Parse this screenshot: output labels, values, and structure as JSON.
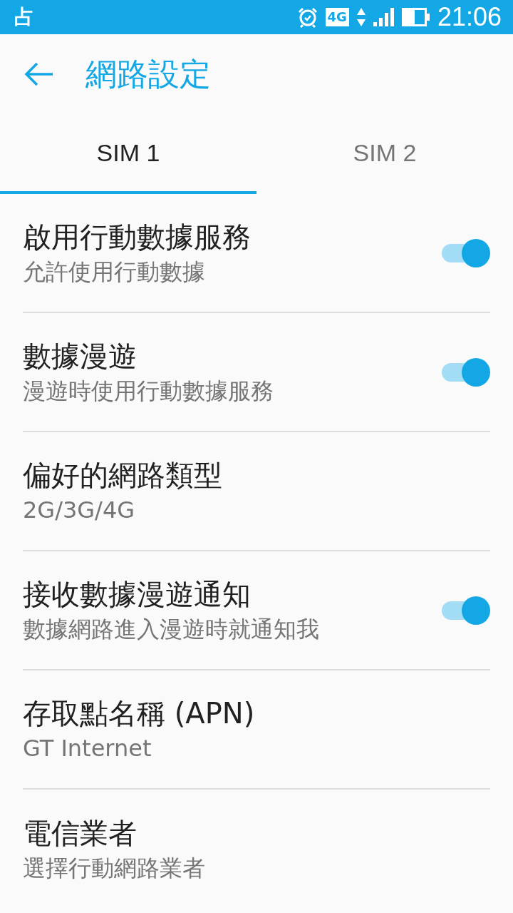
{
  "status_bar": {
    "notification": "占",
    "network_type": "4G",
    "time": "21:06"
  },
  "toolbar": {
    "title": "網路設定"
  },
  "tabs": [
    {
      "label": "SIM 1",
      "selected": true
    },
    {
      "label": "SIM 2",
      "selected": false
    }
  ],
  "settings": [
    {
      "kind": "toggle",
      "title": "啟用行動數據服務",
      "summary": "允許使用行動數據",
      "on": true
    },
    {
      "kind": "toggle",
      "title": "數據漫遊",
      "summary": "漫遊時使用行動數據服務",
      "on": true
    },
    {
      "kind": "plain",
      "title": "偏好的網路類型",
      "summary": "2G/3G/4G"
    },
    {
      "kind": "toggle",
      "title": "接收數據漫遊通知",
      "summary": "數據網路進入漫遊時就通知我",
      "on": true
    },
    {
      "kind": "plain",
      "title": "存取點名稱 (APN)",
      "summary": "GT Internet"
    },
    {
      "kind": "plain",
      "title": "電信業者",
      "summary": "選擇行動網路業者"
    }
  ]
}
